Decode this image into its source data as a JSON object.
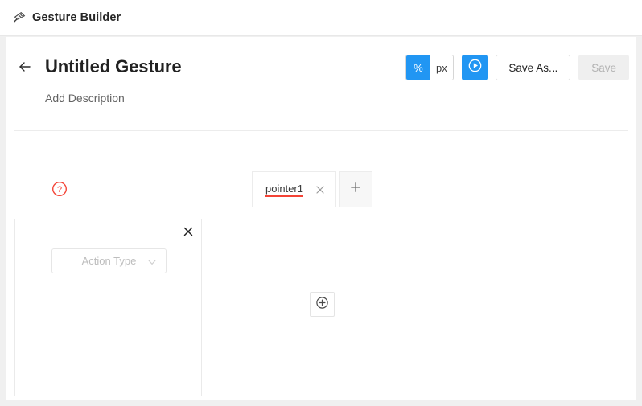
{
  "appbar": {
    "icon": "gesture-swipe-icon",
    "title": "Gesture Builder"
  },
  "header": {
    "back_icon": "back-arrow-icon",
    "title": "Untitled Gesture",
    "description_placeholder": "Add Description"
  },
  "toolbar": {
    "unit_percent": "%",
    "unit_px": "px",
    "active_unit": "%",
    "play_icon": "play-circle-icon",
    "save_as_label": "Save As...",
    "save_label": "Save",
    "save_disabled": true,
    "accent_color": "#2196f3"
  },
  "help": {
    "icon": "help-circle-icon",
    "color": "#f44336"
  },
  "tabs": {
    "items": [
      {
        "label": "pointer1",
        "active": true,
        "error": true,
        "close_icon": "close-icon"
      }
    ],
    "add_tab_icon": "plus-icon",
    "error_color": "#f44336"
  },
  "action_card": {
    "close_icon": "close-icon",
    "action_type_placeholder": "Action Type",
    "chevron_icon": "chevron-down-icon"
  },
  "canvas": {
    "add_action_icon": "plus-circle-icon"
  }
}
